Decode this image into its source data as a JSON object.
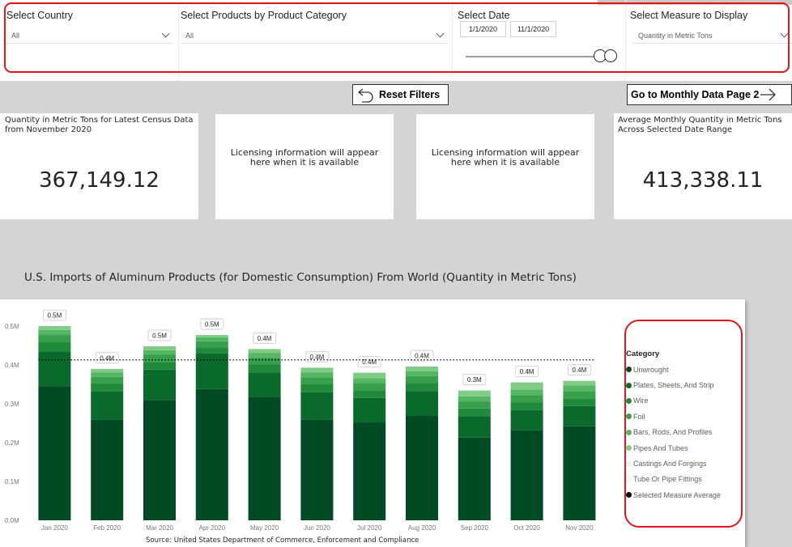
{
  "filters": {
    "country": {
      "title": "Select Country",
      "value": "All"
    },
    "products": {
      "title": "Select Products by Product Category",
      "value": "All"
    },
    "date": {
      "title": "Select Date",
      "start": "1/1/2020",
      "end": "11/1/2020"
    },
    "measure": {
      "title": "Select Measure to Display",
      "value": "Quantity in Metric Tons"
    }
  },
  "buttons": {
    "reset": "Reset Filters",
    "monthly": "Go to Monthly Data Page 2"
  },
  "cards": {
    "latest": {
      "title": "Quantity in Metric Tons for Latest Census Data from November 2020",
      "value": "367,149.12"
    },
    "license1": "Licensing information will appear here when it is available",
    "license2": "Licensing information will appear here when it is available",
    "average": {
      "title": "Average Monthly Quantity in Metric Tons Across Selected Date Range",
      "value": "413,338.11"
    }
  },
  "chart_title": "U.S. Imports of Aluminum Products (for Domestic Consumption) From World (Quantity in Metric Tons)",
  "source": "Source: United States Department of Commerce, Enforcement and Compliance",
  "legend": {
    "title": "Category",
    "items": [
      {
        "label": "Unwrought",
        "color": "#004b23"
      },
      {
        "label": "Plates, Sheets, And Strip",
        "color": "#0a6a2c"
      },
      {
        "label": "Wire",
        "color": "#208a3b"
      },
      {
        "label": "Foil",
        "color": "#38a04d"
      },
      {
        "label": "Bars, Rods, And Profiles",
        "color": "#55b663"
      },
      {
        "label": "Pipes And Tubes",
        "color": "#80cc86"
      },
      {
        "label": "Castings And Forgings",
        "color": "#eef6ee"
      },
      {
        "label": "Tube Or Pipe Fittings",
        "color": "#f6faf6"
      },
      {
        "label": "Selected Measure Average",
        "color": "#000000"
      }
    ]
  },
  "chart_data": {
    "type": "bar",
    "stacked": true,
    "categories": [
      "Jan 2020",
      "Feb 2020",
      "Mar 2020",
      "Apr 2020",
      "May 2020",
      "Jun 2020",
      "Jul 2020",
      "Aug 2020",
      "Sep 2020",
      "Oct 2020",
      "Nov 2020"
    ],
    "yticks": [
      "0.0M",
      "0.1M",
      "0.2M",
      "0.3M",
      "0.4M",
      "0.5M"
    ],
    "ylim": [
      0,
      0.55
    ],
    "average": 0.413,
    "data_labels": [
      "0.5M",
      "0.4M",
      "0.5M",
      "0.5M",
      "0.4M",
      "0.4M",
      "0.4M",
      "0.4M",
      "0.3M",
      "0.4M",
      "0.4M"
    ],
    "series": [
      {
        "name": "Unwrought",
        "values": [
          0.345,
          0.26,
          0.31,
          0.338,
          0.318,
          0.26,
          0.252,
          0.27,
          0.213,
          0.232,
          0.242
        ]
      },
      {
        "name": "Plates, Sheets, And Strip",
        "values": [
          0.09,
          0.072,
          0.078,
          0.092,
          0.063,
          0.07,
          0.063,
          0.063,
          0.055,
          0.052,
          0.052
        ]
      },
      {
        "name": "Wire",
        "values": [
          0.025,
          0.02,
          0.02,
          0.015,
          0.02,
          0.02,
          0.02,
          0.02,
          0.02,
          0.02,
          0.02
        ]
      },
      {
        "name": "Foil",
        "values": [
          0.018,
          0.017,
          0.018,
          0.016,
          0.018,
          0.018,
          0.018,
          0.018,
          0.018,
          0.018,
          0.018
        ]
      },
      {
        "name": "Bars, Rods, And Profiles",
        "values": [
          0.012,
          0.012,
          0.012,
          0.01,
          0.012,
          0.013,
          0.013,
          0.013,
          0.013,
          0.015,
          0.015
        ]
      },
      {
        "name": "Pipes And Tubes",
        "values": [
          0.01,
          0.009,
          0.01,
          0.006,
          0.01,
          0.012,
          0.014,
          0.012,
          0.015,
          0.018,
          0.012
        ]
      },
      {
        "name": "Castings And Forgings",
        "values": [
          0.0,
          0.0,
          0.0,
          0.0,
          0.0,
          0.0,
          0.0,
          0.0,
          0.0,
          0.0,
          0.0
        ]
      },
      {
        "name": "Tube Or Pipe Fittings",
        "values": [
          0.0,
          0.0,
          0.0,
          0.0,
          0.0,
          0.0,
          0.0,
          0.0,
          0.0,
          0.0,
          0.0
        ]
      }
    ]
  }
}
